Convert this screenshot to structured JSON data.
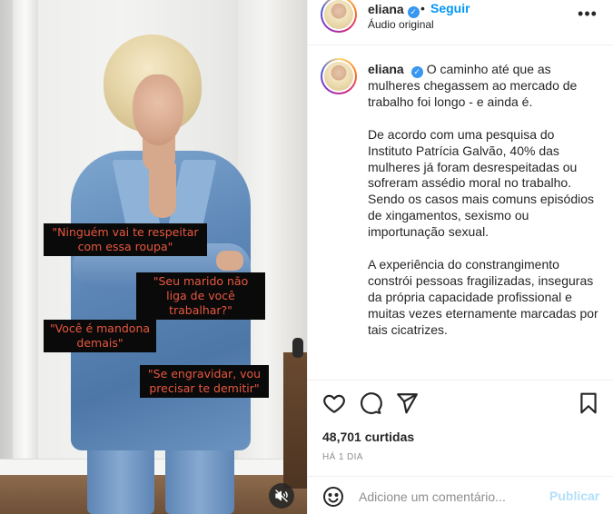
{
  "post": {
    "username": "eliana",
    "follow_label": "Seguir",
    "dot": "•",
    "audio_label": "Áudio original",
    "caption_paragraphs": [
      "O caminho até que as mulheres chegassem ao mercado de trabalho foi longo - e ainda é.",
      "De acordo com uma pesquisa do Instituto Patrícia Galvão, 40% das mulheres já foram desrespeitadas ou sofreram assédio moral no trabalho. Sendo os casos mais comuns episódios de xingamentos, sexismo ou importunação sexual.",
      "A experiência do constrangimento constrói pessoas fragilizadas, inseguras da própria capacidade profissional e muitas vezes eternamente marcadas por tais cicatrizes."
    ],
    "likes": "48,701 curtidas",
    "time_ago": "HÁ 1 DIA"
  },
  "video": {
    "captions": [
      "\"Ninguém vai te respeitar com essa roupa\"",
      "\"Seu marido não liga de você trabalhar?\"",
      "\"Você é mandona demais\"",
      "\"Se engravidar, vou precisar te demitir\""
    ],
    "mute_icon": "muted-speaker-icon"
  },
  "comment_box": {
    "placeholder": "Adicione um comentário...",
    "publish_label": "Publicar"
  },
  "icons": {
    "more": "more-options-icon",
    "like": "heart-icon",
    "comment": "comment-icon",
    "share": "send-icon",
    "save": "bookmark-icon",
    "emoji": "emoji-icon",
    "verified": "verified-badge-icon"
  },
  "colors": {
    "accent": "#0095f6",
    "verified": "#3897f0",
    "publish_disabled": "#b2dffc",
    "caption_text": "#e8573f"
  }
}
